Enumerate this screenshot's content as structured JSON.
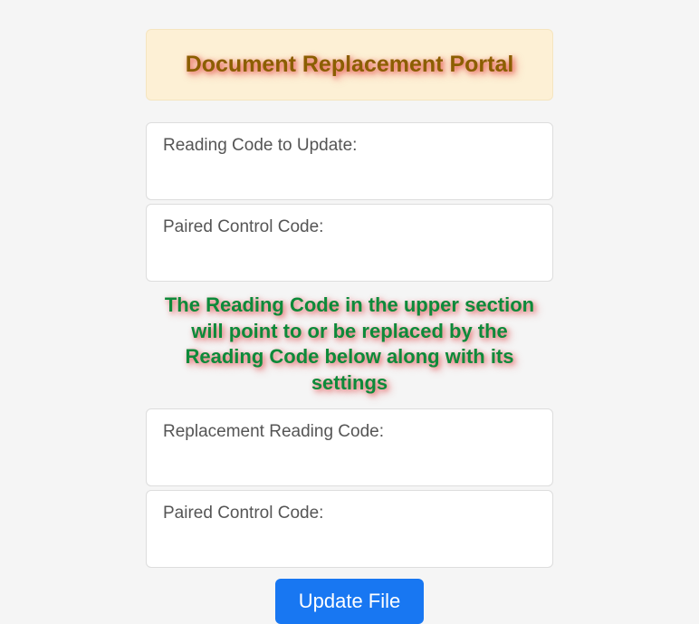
{
  "header": {
    "title": "Document Replacement Portal"
  },
  "form": {
    "reading_code_label": "Reading Code to Update:",
    "paired_control_label_1": "Paired Control Code:",
    "instruction_text": "The Reading Code in the upper section will point to or be replaced by the Reading Code below along with its settings",
    "replacement_reading_label": "Replacement Reading Code:",
    "paired_control_label_2": "Paired Control Code:",
    "submit_label": "Update File"
  }
}
